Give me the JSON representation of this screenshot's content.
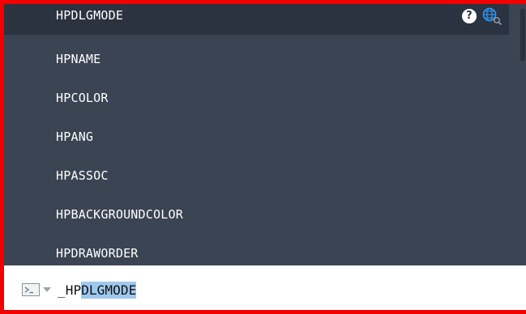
{
  "autocomplete": {
    "items": [
      {
        "label": "HPDLGMODE"
      },
      {
        "label": "HPNAME"
      },
      {
        "label": "HPCOLOR"
      },
      {
        "label": "HPANG"
      },
      {
        "label": "HPASSOC"
      },
      {
        "label": "HPBACKGROUNDCOLOR"
      },
      {
        "label": "HPDRAWORDER"
      }
    ],
    "highlighted_index": 0,
    "help_icon_glyph": "?",
    "icons": [
      "help-icon",
      "web-search-icon"
    ]
  },
  "command_line": {
    "typed": "_HP",
    "suggested": "DLGMODE",
    "icon": "command-prompt-icon"
  },
  "colors": {
    "border": "#f20000",
    "list_background": "#3b4453",
    "highlight_background": "#2b3240",
    "selection": "#9fc8ee",
    "web_icon": "#2f8ee0"
  }
}
